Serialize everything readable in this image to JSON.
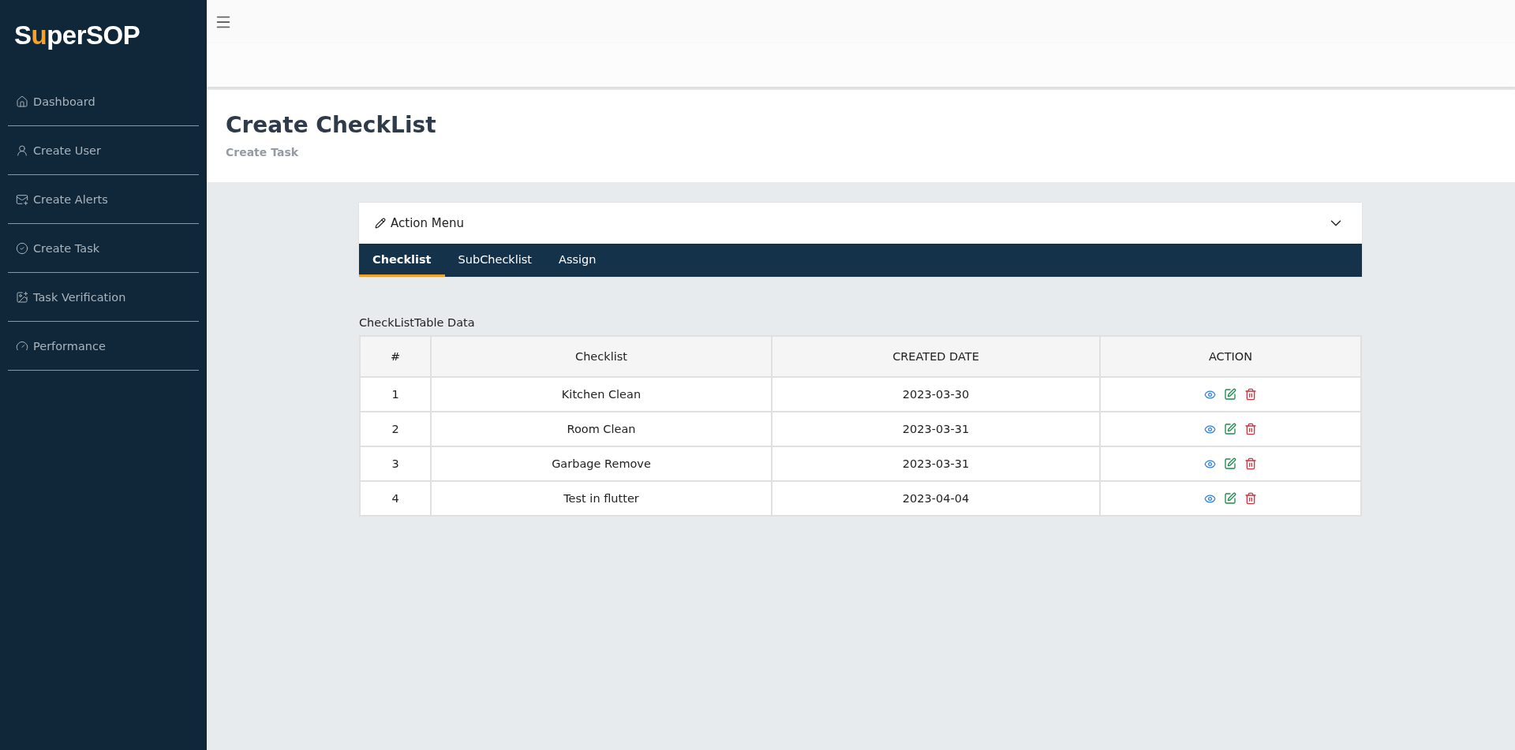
{
  "sidebar": {
    "logo": "SuperSOP",
    "items": [
      {
        "label": "Dashboard",
        "selected": false
      },
      {
        "label": "Create User",
        "selected": false
      },
      {
        "label": "Create Alerts",
        "selected": false
      },
      {
        "label": "Create Task",
        "selected": false
      },
      {
        "label": "Task Verification",
        "selected": false
      },
      {
        "label": "Performance",
        "selected": false
      }
    ]
  },
  "header": {
    "title": "Create CheckList",
    "subtitle": "Create Task"
  },
  "action_menu": {
    "title": "Action Menu",
    "expanded": true,
    "tabs": [
      {
        "label": "Checklist",
        "selected": true
      },
      {
        "label": "SubChecklist",
        "selected": false
      },
      {
        "label": "Assign",
        "selected": false
      }
    ]
  },
  "table": {
    "caption": "CheckListTable Data",
    "columns": [
      "#",
      "Checklist",
      "CREATED DATE",
      "ACTION"
    ],
    "rows": [
      {
        "number": "1",
        "checklist": "Kitchen Clean",
        "created_date": "2023-03-30"
      },
      {
        "number": "2",
        "checklist": "Room Clean",
        "created_date": "2023-03-31"
      },
      {
        "number": "3",
        "checklist": "Garbage Remove",
        "created_date": "2023-03-31"
      },
      {
        "number": "4",
        "checklist": "Test in flutter",
        "created_date": "2023-04-04"
      }
    ]
  }
}
